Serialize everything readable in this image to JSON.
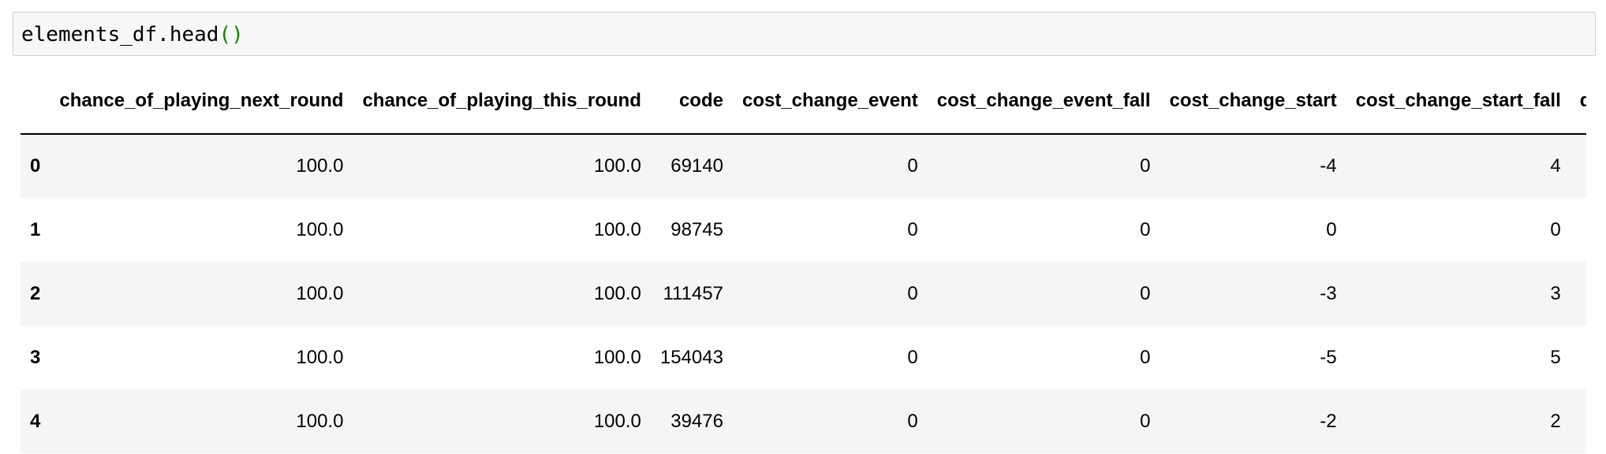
{
  "code_cell": {
    "prefix": "elements_df.head",
    "parens": "()"
  },
  "table": {
    "columns": [
      "",
      "chance_of_playing_next_round",
      "chance_of_playing_this_round",
      "code",
      "cost_change_event",
      "cost_change_event_fall",
      "cost_change_start",
      "cost_change_start_fall",
      "dr"
    ],
    "rows": [
      {
        "index": "0",
        "cells": [
          "100.0",
          "100.0",
          "69140",
          "0",
          "0",
          "-4",
          "4"
        ]
      },
      {
        "index": "1",
        "cells": [
          "100.0",
          "100.0",
          "98745",
          "0",
          "0",
          "0",
          "0"
        ]
      },
      {
        "index": "2",
        "cells": [
          "100.0",
          "100.0",
          "111457",
          "0",
          "0",
          "-3",
          "3"
        ]
      },
      {
        "index": "3",
        "cells": [
          "100.0",
          "100.0",
          "154043",
          "0",
          "0",
          "-5",
          "5"
        ]
      },
      {
        "index": "4",
        "cells": [
          "100.0",
          "100.0",
          "39476",
          "0",
          "0",
          "-2",
          "2"
        ]
      }
    ]
  }
}
